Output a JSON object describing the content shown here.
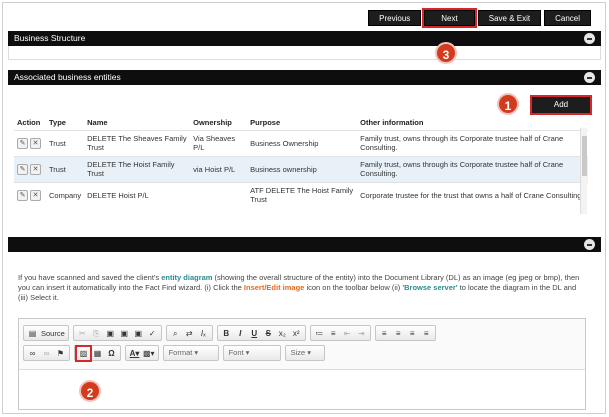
{
  "topbar": {
    "previous": "Previous",
    "next": "Next",
    "save_exit": "Save & Exit",
    "cancel": "Cancel"
  },
  "panels": {
    "business_structure": "Business Structure",
    "associated": "Associated business entities",
    "blank": ""
  },
  "add_label": "Add",
  "badges": {
    "b1": "1",
    "b2": "2",
    "b3": "3"
  },
  "table": {
    "headers": [
      "Action",
      "Type",
      "Name",
      "Ownership",
      "Purpose",
      "Other information"
    ],
    "rows": [
      {
        "type": "Trust",
        "name": "DELETE The Sheaves Family Trust",
        "ownership": "Via Sheaves P/L",
        "purpose": "Business Ownership",
        "info": "Family trust, owns through its Corporate trustee half of Crane Consulting."
      },
      {
        "type": "Trust",
        "name": "DELETE The Hoist Family Trust",
        "ownership": "via Hoist P/L",
        "purpose": "Business ownership",
        "info": "Family trust, owns through its Corporate trustee half of Crane Consulting."
      },
      {
        "type": "Company",
        "name": "DELETE Hoist P/L",
        "ownership": "",
        "purpose": "ATF DELETE The Hoist Family Trust",
        "info": "Corporate trustee for the trust that owns a half of Crane Consulting."
      }
    ]
  },
  "description": {
    "p1": "If you have scanned and saved the client's ",
    "link1": "entity diagram",
    "p2": " (showing the overall structure of the entity) into the Document Library (DL) as an image (eg jpeg or bmp), then you can insert it automatically into the Fact Find wizard. (i) Click the ",
    "link2": "Insert/Edit image",
    "p3": " icon on the toolbar below (ii) ",
    "link3": "'Browse server'",
    "p4": " to locate the diagram in the DL and (iii) Select it."
  },
  "editor": {
    "source": "Source",
    "format": "Format",
    "font": "Font",
    "size": "Size"
  }
}
